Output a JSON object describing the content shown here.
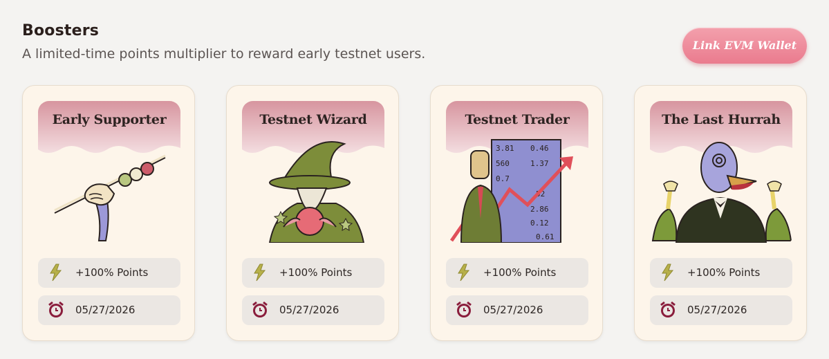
{
  "header": {
    "title": "Boosters",
    "subtitle": "A limited-time points multiplier to reward early testnet users."
  },
  "wallet_button": {
    "label": "Link EVM Wallet"
  },
  "colors": {
    "banner_pink": "#d9a0aa",
    "lightning": "#b7b04a",
    "alarm": "#8a1d3c",
    "button_pink": "#ea7b8e"
  },
  "cards": [
    {
      "title": "Early Supporter",
      "icon": "kebab-hand-illustration",
      "points": "+100% Points",
      "date": "05/27/2026"
    },
    {
      "title": "Testnet Wizard",
      "icon": "wizard-illustration",
      "points": "+100% Points",
      "date": "05/27/2026"
    },
    {
      "title": "Testnet Trader",
      "icon": "trader-illustration",
      "points": "+100% Points",
      "date": "05/27/2026"
    },
    {
      "title": "The Last Hurrah",
      "icon": "party-bird-illustration",
      "points": "+100% Points",
      "date": "05/27/2026"
    }
  ],
  "trader_board": [
    "3.81",
    "0.46",
    "560",
    "1.37",
    "0.7",
    "52",
    "2.86",
    "0.12",
    "0.61"
  ]
}
